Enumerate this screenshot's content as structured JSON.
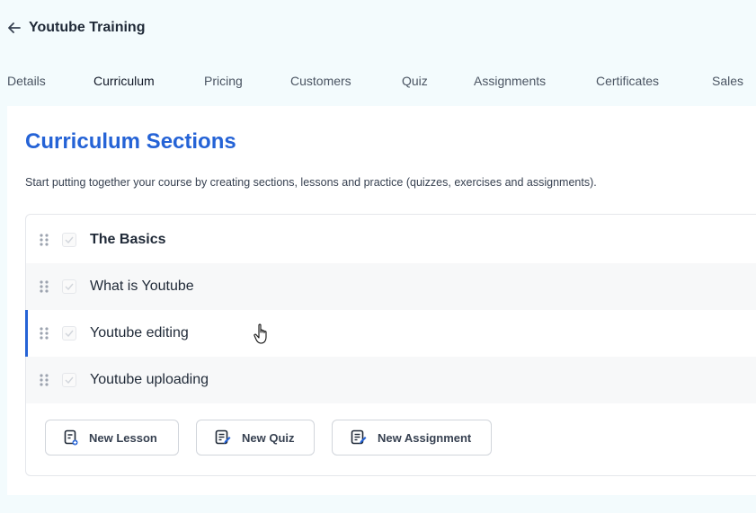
{
  "header": {
    "back_icon": "arrow-left-icon",
    "title": "Youtube Training"
  },
  "tabs": [
    {
      "label": "Details",
      "active": false
    },
    {
      "label": "Curriculum",
      "active": true
    },
    {
      "label": "Pricing",
      "active": false
    },
    {
      "label": "Customers",
      "active": false
    },
    {
      "label": "Quiz",
      "active": false
    },
    {
      "label": "Assignments",
      "active": false
    },
    {
      "label": "Certificates",
      "active": false
    },
    {
      "label": "Sales",
      "active": false
    }
  ],
  "main": {
    "heading": "Curriculum Sections",
    "description": "Start putting together your course by creating sections, lessons and practice (quizzes, exercises and assignments).",
    "items": [
      {
        "label": "The Basics",
        "type": "section"
      },
      {
        "label": "What is Youtube",
        "type": "lesson"
      },
      {
        "label": "Youtube editing",
        "type": "lesson",
        "selected": true
      },
      {
        "label": "Youtube uploading",
        "type": "lesson"
      }
    ],
    "actions": {
      "new_lesson": "New Lesson",
      "new_quiz": "New Quiz",
      "new_assignment": "New Assignment"
    }
  },
  "colors": {
    "accent": "#2563d6",
    "background": "#f3fbfd"
  }
}
